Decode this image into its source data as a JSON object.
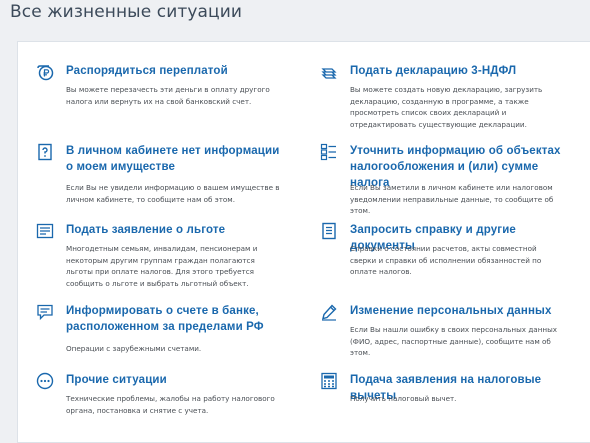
{
  "page": {
    "title": "Все жизненные ситуации"
  },
  "colors": {
    "accent": "#1a68ad",
    "text": "#4a4f55",
    "title": "#3c4a5a"
  },
  "items": [
    {
      "icon": "ruble-circle-icon",
      "title": "Распорядиться переплатой",
      "desc": "Вы можете перезачесть эти деньги в оплату другого налога или вернуть их на свой банковский счет."
    },
    {
      "icon": "declaration-stack-icon",
      "title": "Подать декларацию 3-НДФЛ",
      "desc": "Вы можете создать новую декларацию, загрузить декларацию, созданную в программе, а также просмотреть список своих деклараций и отредактировать существующие декларации."
    },
    {
      "icon": "question-document-icon",
      "title": "В личном кабинете нет информации о моем имуществе",
      "desc": "Если Вы не увидели информацию о вашем имуществе в личном кабинете, то сообщите нам об этом."
    },
    {
      "icon": "checklist-icon",
      "title": "Уточнить информацию об объектах налогообложения и (или) сумме налога",
      "desc": "Если Вы заметили в личном кабинете или налоговом уведомлении неправильные данные, то сообщите об этом."
    },
    {
      "icon": "application-form-icon",
      "title": "Подать заявление о льготе",
      "desc": "Многодетным семьям, инвалидам, пенсионерам и некоторым другим группам граждан полагаются льготы при оплате налогов. Для этого требуется сообщить о льготе и выбрать льготный объект."
    },
    {
      "icon": "document-lines-icon",
      "title": "Запросить справку и другие документы",
      "desc": "Справки о состоянии расчетов, акты совместной сверки и справки об исполнении обязанностей по оплате налогов."
    },
    {
      "icon": "message-bubble-icon",
      "title": "Информировать о счете в банке, расположенном за пределами РФ",
      "desc": "Операции с зарубежными счетами."
    },
    {
      "icon": "pencil-icon",
      "title": "Изменение персональных данных",
      "desc": "Если Вы нашли ошибку в своих персональных данных (ФИО, адрес, паспортные данные), сообщите нам об этом."
    },
    {
      "icon": "ellipsis-circle-icon",
      "title": "Прочие ситуации",
      "desc": "Технические проблемы, жалобы на работу налогового органа, постановка и снятие с учета."
    },
    {
      "icon": "calculator-icon",
      "title": "Подача заявления на налоговые вычеты",
      "desc": "Получить налоговый вычет."
    }
  ]
}
